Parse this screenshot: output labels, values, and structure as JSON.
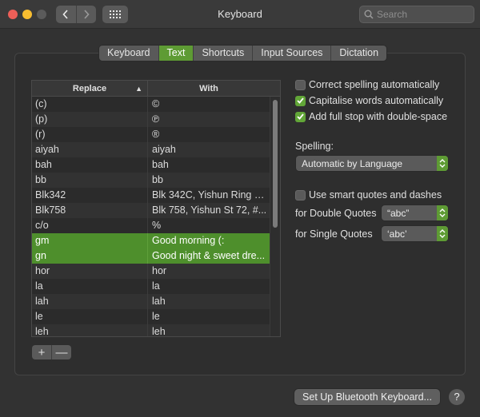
{
  "window": {
    "title": "Keyboard",
    "back_icon": "chevron-left-icon",
    "forward_icon": "chevron-right-icon",
    "grid_icon": "grid-icon"
  },
  "search": {
    "placeholder": "Search",
    "value": ""
  },
  "tabs": [
    {
      "label": "Keyboard",
      "active": false
    },
    {
      "label": "Text",
      "active": true
    },
    {
      "label": "Shortcuts",
      "active": false
    },
    {
      "label": "Input Sources",
      "active": false
    },
    {
      "label": "Dictation",
      "active": false
    }
  ],
  "table": {
    "headers": {
      "replace": "Replace",
      "with": "With"
    },
    "sort": "ascending",
    "rows": [
      {
        "replace": "(c)",
        "with": "©",
        "selected": false
      },
      {
        "replace": "(p)",
        "with": "℗",
        "selected": false
      },
      {
        "replace": "(r)",
        "with": "®",
        "selected": false
      },
      {
        "replace": "aiyah",
        "with": "aiyah",
        "selected": false
      },
      {
        "replace": "bah",
        "with": "bah",
        "selected": false
      },
      {
        "replace": "bb",
        "with": "bb",
        "selected": false
      },
      {
        "replace": "Blk342",
        "with": "Blk 342C, Yishun Ring R...",
        "selected": false
      },
      {
        "replace": "Blk758",
        "with": "Blk 758, Yishun St 72, #...",
        "selected": false
      },
      {
        "replace": "c/o",
        "with": "%",
        "selected": false
      },
      {
        "replace": "gm",
        "with": "Good morning (:",
        "selected": true
      },
      {
        "replace": "gn",
        "with": "Good night & sweet dre...",
        "selected": true
      },
      {
        "replace": "hor",
        "with": "hor",
        "selected": false
      },
      {
        "replace": "la",
        "with": "la",
        "selected": false
      },
      {
        "replace": "lah",
        "with": "lah",
        "selected": false
      },
      {
        "replace": "le",
        "with": "le",
        "selected": false
      },
      {
        "replace": "leh",
        "with": "leh",
        "selected": false
      }
    ],
    "add_label": "+",
    "remove_label": "—"
  },
  "options": {
    "correct_spelling": {
      "label": "Correct spelling automatically",
      "checked": false
    },
    "capitalise_words": {
      "label": "Capitalise words automatically",
      "checked": true
    },
    "full_stop": {
      "label": "Add full stop with double-space",
      "checked": true
    },
    "spelling_label": "Spelling:",
    "spelling_value": "Automatic by Language",
    "smart_quotes": {
      "label": "Use smart quotes and dashes",
      "checked": false
    },
    "double_quotes_label": "for Double Quotes",
    "double_quotes_value": "“abc”",
    "single_quotes_label": "for Single Quotes",
    "single_quotes_value": "‘abc’"
  },
  "footer": {
    "bluetooth_button": "Set Up Bluetooth Keyboard...",
    "help_label": "?"
  },
  "colors": {
    "accent": "#5e9b34",
    "selection": "#4e8f2c",
    "close": "#ee5f58",
    "minimize": "#f8bd30"
  }
}
